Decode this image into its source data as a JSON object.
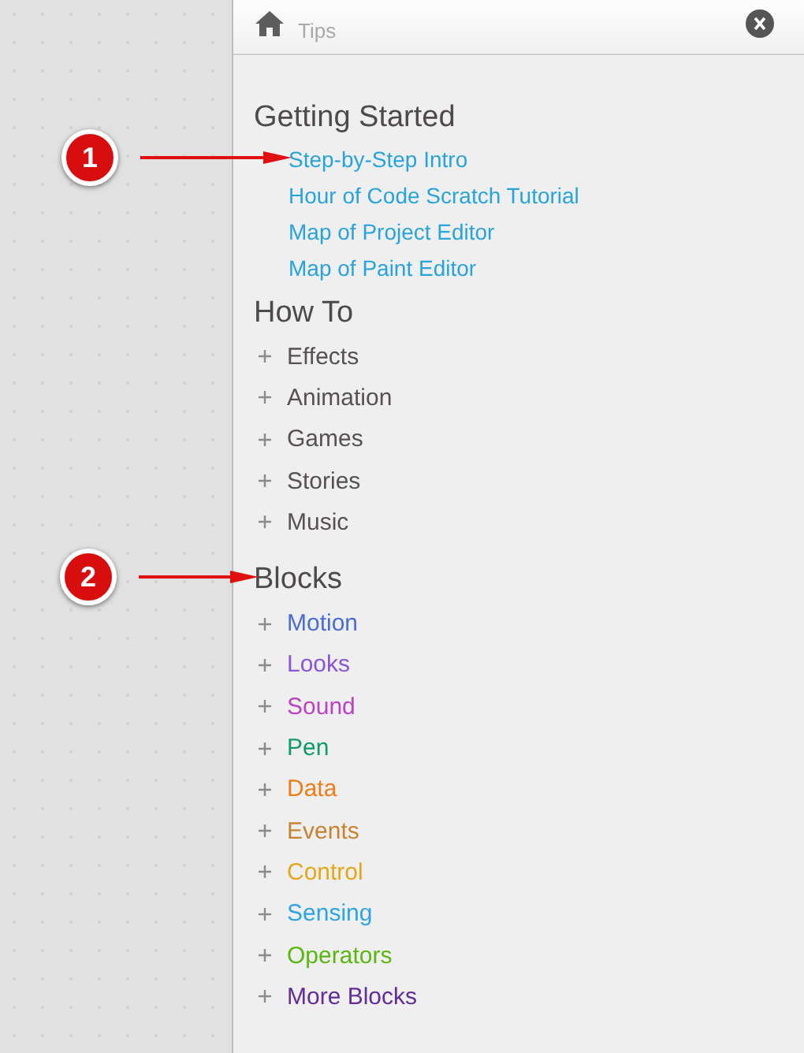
{
  "panel": {
    "title": "Tips"
  },
  "sections": [
    {
      "heading": "Getting Started",
      "kind": "links",
      "items": [
        {
          "label": "Step-by-Step Intro",
          "callout": "1"
        },
        {
          "label": "Hour of Code Scratch Tutorial"
        },
        {
          "label": "Map of Project Editor"
        },
        {
          "label": "Map of Paint Editor"
        }
      ]
    },
    {
      "heading": "How To",
      "kind": "topics",
      "items": [
        {
          "label": "Effects"
        },
        {
          "label": "Animation"
        },
        {
          "label": "Games"
        },
        {
          "label": "Stories"
        },
        {
          "label": "Music"
        }
      ]
    },
    {
      "heading": "Blocks",
      "kind": "topics",
      "callout": "2",
      "items": [
        {
          "label": "Motion",
          "color": "#4a6cd4"
        },
        {
          "label": "Looks",
          "color": "#8a55d7"
        },
        {
          "label": "Sound",
          "color": "#bb42c3"
        },
        {
          "label": "Pen",
          "color": "#0e9a6c"
        },
        {
          "label": "Data",
          "color": "#ee7d16"
        },
        {
          "label": "Events",
          "color": "#c88330"
        },
        {
          "label": "Control",
          "color": "#e1a91a"
        },
        {
          "label": "Sensing",
          "color": "#2ca5e2"
        },
        {
          "label": "Operators",
          "color": "#5cb712"
        },
        {
          "label": "More Blocks",
          "color": "#632d99"
        }
      ]
    }
  ]
}
